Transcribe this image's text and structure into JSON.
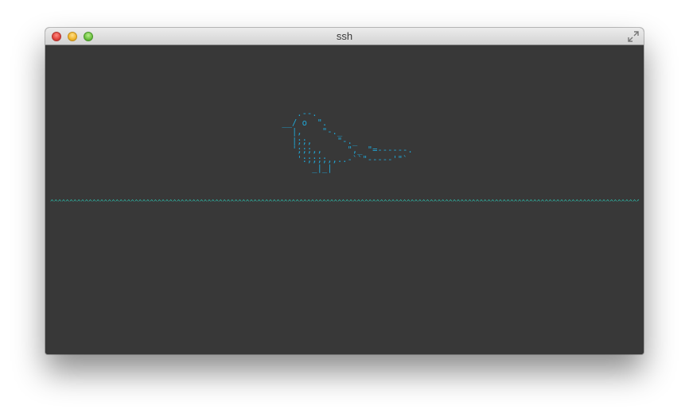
{
  "window": {
    "title": "ssh"
  },
  "terminal": {
    "ascii_art": "    .--.\n __/ o  \".\n   |,    \"-._\n   |;;,     \"-._\n   ';;;,,     \",_ \"=------.\n    ':;;;;,,..-``\"-----'\"`\n       _|_|",
    "ground": "^^^^^^^^^^^^^^^^^^^^^^^^^^^^^^^^^^^^^^^^^^^^^^^^^^^^^^^^^^^^^^^^^^^^^^^^^^^^^^^^^^^^^^^^^^^^^^^^^^^^^^^^^^^^^^^^^^^^^^^^^^^^^^^^^^^^^^^^^^^^^^^^^^^^^^^^^^^^^^^^^^^^^^^^^^^^^^^^^^^^^^",
    "colors": {
      "background": "#383838",
      "bird": "#1fa8d8",
      "ground": "#2bc7b4"
    }
  },
  "icons": {
    "close": "close-button-icon",
    "minimize": "minimize-button-icon",
    "zoom": "zoom-button-icon",
    "fullscreen": "fullscreen-arrows-icon"
  }
}
